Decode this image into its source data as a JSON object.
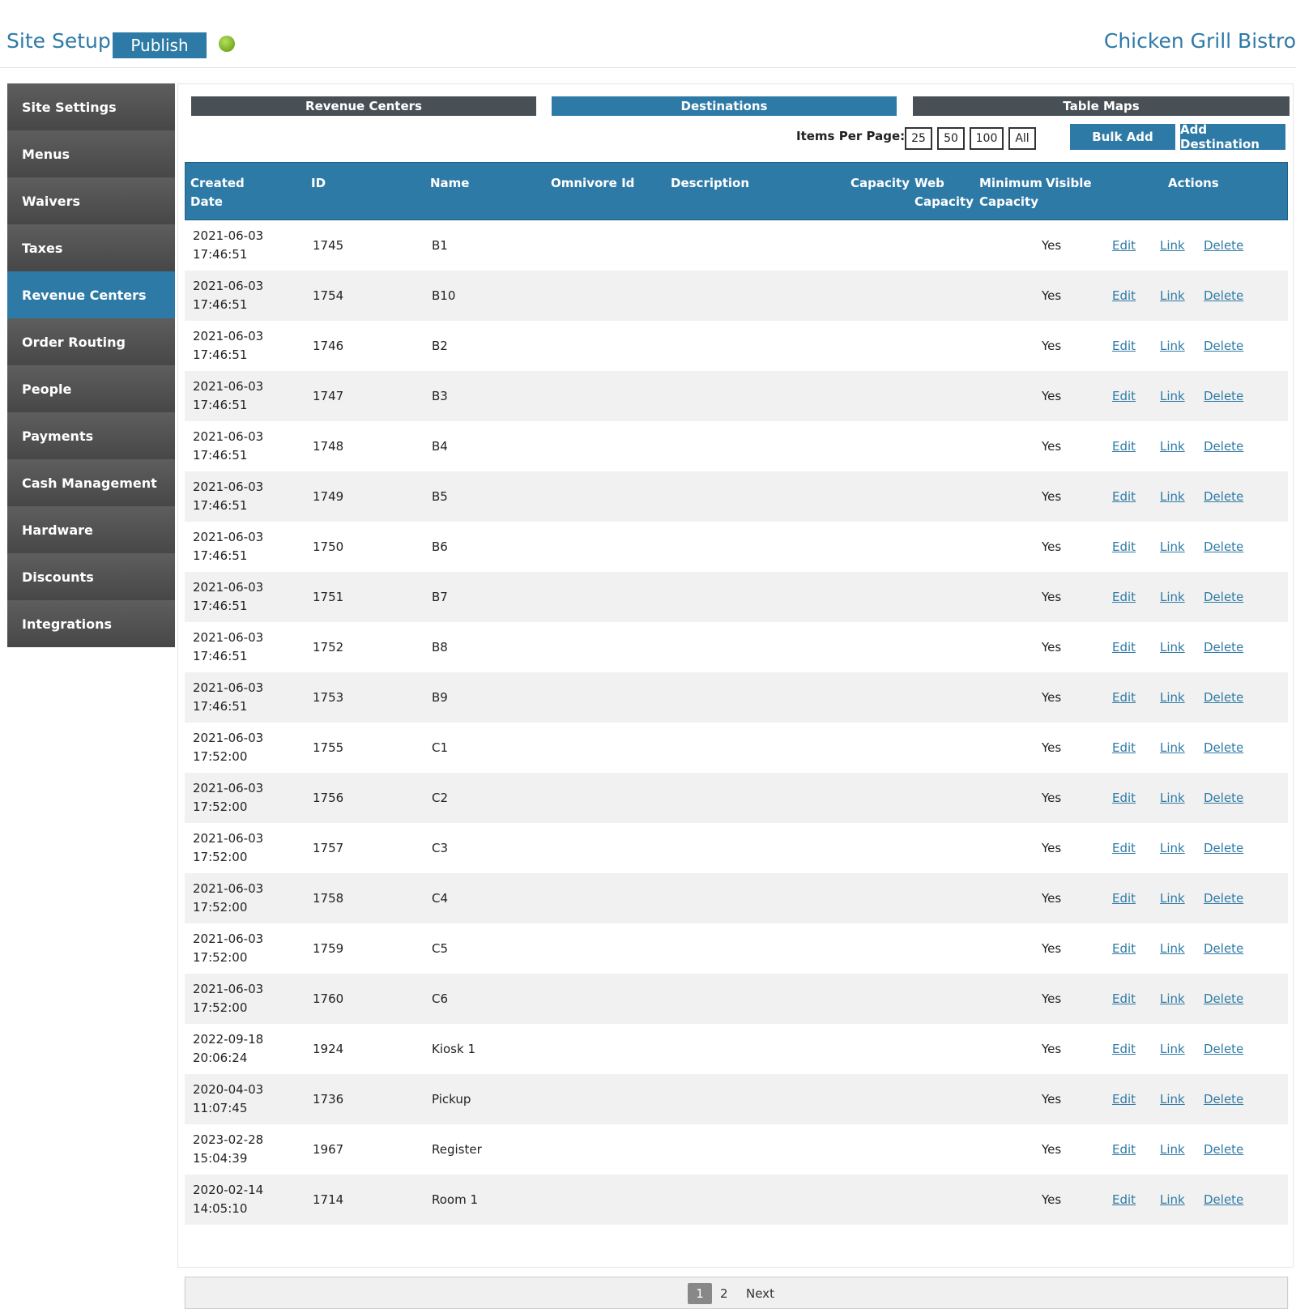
{
  "header": {
    "title": "Site Setup",
    "publish_label": "Publish",
    "status": "green",
    "restaurant": "Chicken Grill Bistro"
  },
  "sidebar": {
    "items": [
      {
        "label": "Site Settings",
        "active": false
      },
      {
        "label": "Menus",
        "active": false
      },
      {
        "label": "Waivers",
        "active": false
      },
      {
        "label": "Taxes",
        "active": false
      },
      {
        "label": "Revenue Centers",
        "active": true
      },
      {
        "label": "Order Routing",
        "active": false
      },
      {
        "label": "People",
        "active": false
      },
      {
        "label": "Payments",
        "active": false
      },
      {
        "label": "Cash Management",
        "active": false
      },
      {
        "label": "Hardware",
        "active": false
      },
      {
        "label": "Discounts",
        "active": false
      },
      {
        "label": "Integrations",
        "active": false
      }
    ]
  },
  "tabs": [
    {
      "label": "Revenue Centers",
      "active": false
    },
    {
      "label": "Destinations",
      "active": true
    },
    {
      "label": "Table Maps",
      "active": false
    }
  ],
  "toolbar": {
    "items_per_page_label": "Items Per Page:",
    "page_sizes": [
      "25",
      "50",
      "100",
      "All"
    ],
    "bulk_add_label": "Bulk Add",
    "add_destination_label": "Add Destination"
  },
  "table": {
    "columns": {
      "created_date": "Created Date",
      "id": "ID",
      "name": "Name",
      "omnivore_id": "Omnivore Id",
      "description": "Description",
      "capacity": "Capacity",
      "web_capacity": "Web Capacity",
      "minimum_capacity": "Minimum Capacity",
      "visible": "Visible",
      "actions": "Actions"
    },
    "action_labels": {
      "edit": "Edit",
      "link": "Link",
      "delete": "Delete"
    },
    "rows": [
      {
        "date": "2021-06-03",
        "time": "17:46:51",
        "id": "1745",
        "name": "B1",
        "visible": "Yes"
      },
      {
        "date": "2021-06-03",
        "time": "17:46:51",
        "id": "1754",
        "name": "B10",
        "visible": "Yes"
      },
      {
        "date": "2021-06-03",
        "time": "17:46:51",
        "id": "1746",
        "name": "B2",
        "visible": "Yes"
      },
      {
        "date": "2021-06-03",
        "time": "17:46:51",
        "id": "1747",
        "name": "B3",
        "visible": "Yes"
      },
      {
        "date": "2021-06-03",
        "time": "17:46:51",
        "id": "1748",
        "name": "B4",
        "visible": "Yes"
      },
      {
        "date": "2021-06-03",
        "time": "17:46:51",
        "id": "1749",
        "name": "B5",
        "visible": "Yes"
      },
      {
        "date": "2021-06-03",
        "time": "17:46:51",
        "id": "1750",
        "name": "B6",
        "visible": "Yes"
      },
      {
        "date": "2021-06-03",
        "time": "17:46:51",
        "id": "1751",
        "name": "B7",
        "visible": "Yes"
      },
      {
        "date": "2021-06-03",
        "time": "17:46:51",
        "id": "1752",
        "name": "B8",
        "visible": "Yes"
      },
      {
        "date": "2021-06-03",
        "time": "17:46:51",
        "id": "1753",
        "name": "B9",
        "visible": "Yes"
      },
      {
        "date": "2021-06-03",
        "time": "17:52:00",
        "id": "1755",
        "name": "C1",
        "visible": "Yes"
      },
      {
        "date": "2021-06-03",
        "time": "17:52:00",
        "id": "1756",
        "name": "C2",
        "visible": "Yes"
      },
      {
        "date": "2021-06-03",
        "time": "17:52:00",
        "id": "1757",
        "name": "C3",
        "visible": "Yes"
      },
      {
        "date": "2021-06-03",
        "time": "17:52:00",
        "id": "1758",
        "name": "C4",
        "visible": "Yes"
      },
      {
        "date": "2021-06-03",
        "time": "17:52:00",
        "id": "1759",
        "name": "C5",
        "visible": "Yes"
      },
      {
        "date": "2021-06-03",
        "time": "17:52:00",
        "id": "1760",
        "name": "C6",
        "visible": "Yes"
      },
      {
        "date": "2022-09-18",
        "time": "20:06:24",
        "id": "1924",
        "name": "Kiosk 1",
        "visible": "Yes"
      },
      {
        "date": "2020-04-03",
        "time": "11:07:45",
        "id": "1736",
        "name": "Pickup",
        "visible": "Yes"
      },
      {
        "date": "2023-02-28",
        "time": "15:04:39",
        "id": "1967",
        "name": "Register",
        "visible": "Yes"
      },
      {
        "date": "2020-02-14",
        "time": "14:05:10",
        "id": "1714",
        "name": "Room 1",
        "visible": "Yes"
      }
    ]
  },
  "pagination": {
    "current": "1",
    "pages": [
      "2"
    ],
    "next_label": "Next"
  }
}
